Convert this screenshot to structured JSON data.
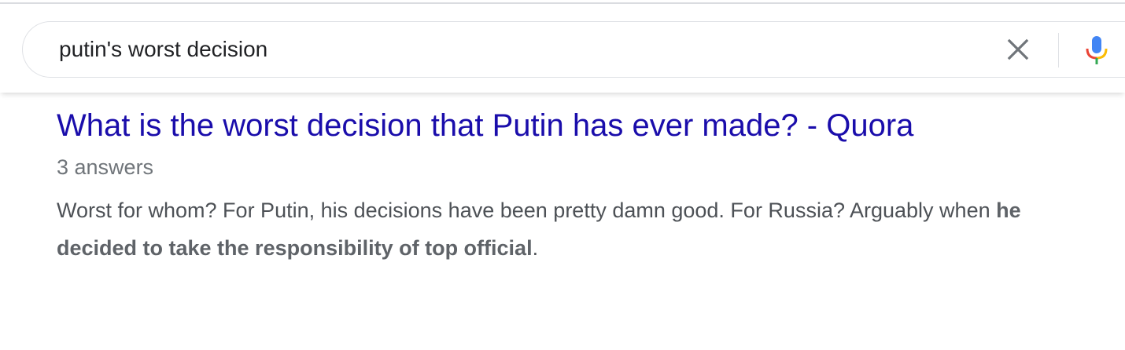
{
  "search": {
    "query": "putin's worst decision"
  },
  "icons": {
    "clear": "close-icon",
    "mic": "microphone-icon"
  },
  "colors": {
    "link": "#1a0dab",
    "meta": "#70757a",
    "snippet": "#4d5156",
    "mic_blue": "#4285f4",
    "mic_red": "#ea4335",
    "mic_yellow": "#fbbc05",
    "mic_green": "#34a853"
  },
  "result": {
    "title": "What is the worst decision that Putin has ever made? - Quora",
    "meta": "3 answers",
    "snippet_before": "Worst for whom? For Putin, his decisions have been pretty damn good. For Russia? Arguably when ",
    "snippet_bold": "he decided to take the responsibility of top official",
    "snippet_after": "."
  }
}
